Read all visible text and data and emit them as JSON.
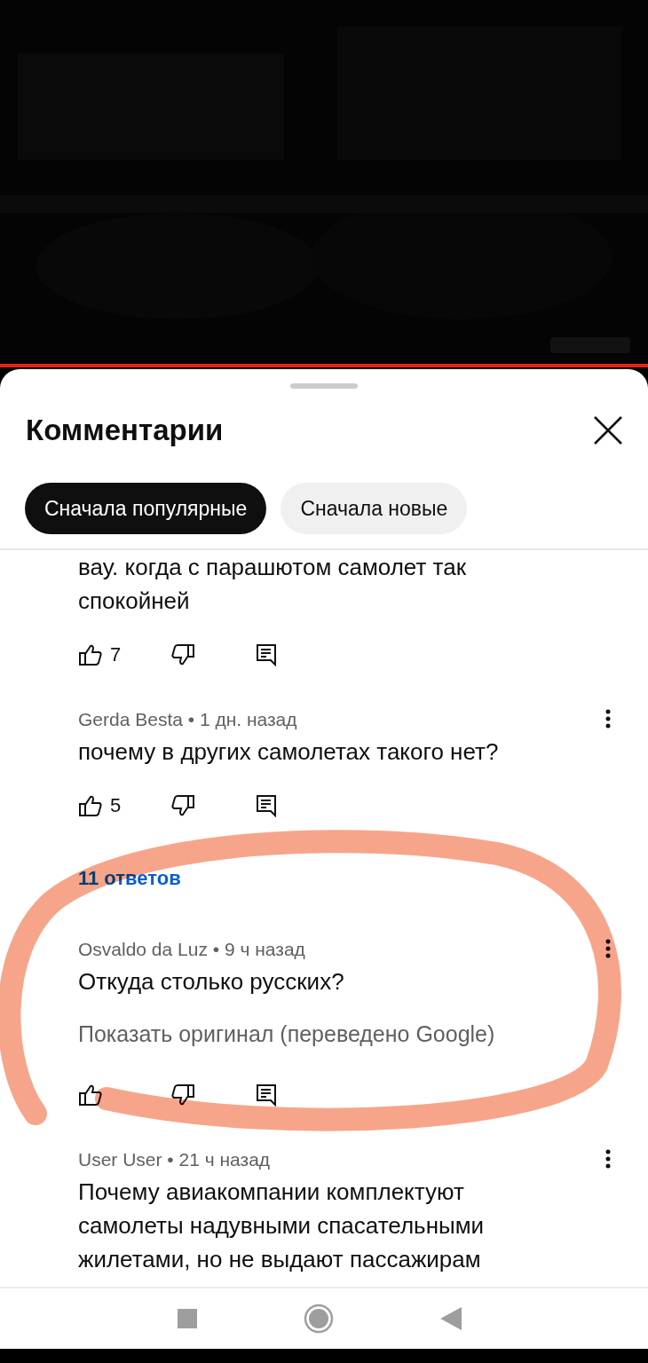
{
  "video": {
    "kind": "picture",
    "progress": {
      "level": 1
    }
  },
  "sheet": {
    "title": "Комментарии",
    "sort_chips": [
      {
        "label": "Сначала популярные",
        "selected": true
      },
      {
        "label": "Сначала новые",
        "selected": false
      }
    ]
  },
  "comments": [
    {
      "text": "вау. когда с парашютом самолет так спокойней",
      "likes": "7"
    },
    {
      "byline": "Gerda Besta • 1 дн. назад",
      "text": "почему в других самолетах такого нет?",
      "likes": "5",
      "replies": "11 ответов"
    },
    {
      "byline": "Osvaldo da Luz • 9 ч назад",
      "text": "Откуда столько русских?",
      "translation": "Показать оригинал (переведено Google)"
    },
    {
      "byline": "User User • 21 ч назад",
      "text": "Почему авиакомпании комплектуют самолеты надувными спасательными жилетами, но не выдают пассажирам"
    }
  ],
  "highlight": {
    "color": "#f7a58a"
  }
}
